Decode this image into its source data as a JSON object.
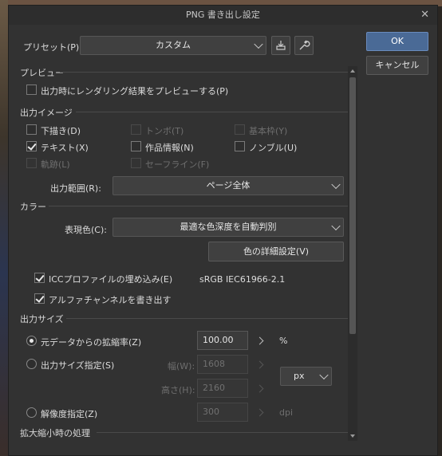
{
  "window": {
    "title": "PNG 書き出し設定",
    "close": "✕"
  },
  "preset": {
    "label": "プリセット(P):",
    "value": "カスタム"
  },
  "buttons": {
    "ok": "OK",
    "cancel": "キャンセル"
  },
  "preview": {
    "section": "プレビュー",
    "option": "出力時にレンダリング結果をプレビューする(P)",
    "checked": false
  },
  "output_image": {
    "section": "出力イメージ",
    "options": [
      {
        "label": "下描き(D)",
        "checked": false,
        "enabled": true
      },
      {
        "label": "トンボ(T)",
        "checked": false,
        "enabled": false
      },
      {
        "label": "基本枠(Y)",
        "checked": false,
        "enabled": false
      },
      {
        "label": "テキスト(X)",
        "checked": true,
        "enabled": true
      },
      {
        "label": "作品情報(N)",
        "checked": false,
        "enabled": true
      },
      {
        "label": "ノンブル(U)",
        "checked": false,
        "enabled": true
      },
      {
        "label": "軌跡(L)",
        "checked": false,
        "enabled": false
      },
      {
        "label": "セーフライン(F)",
        "checked": false,
        "enabled": false
      }
    ],
    "range_label": "出力範囲(R):",
    "range_value": "ページ全体"
  },
  "color": {
    "section": "カラー",
    "mode_label": "表現色(C):",
    "mode_value": "最適な色深度を自動判別",
    "detail_button": "色の詳細設定(V)",
    "icc_label": "ICCプロファイルの埋め込み(E)",
    "icc_checked": true,
    "icc_profile": "sRGB IEC61966-2.1",
    "alpha_label": "アルファチャンネルを書き出す",
    "alpha_checked": true
  },
  "output_size": {
    "section": "出力サイズ",
    "scale_label": "元データからの拡縮率(Z)",
    "scale_value": "100.00",
    "scale_unit": "%",
    "size_label": "出力サイズ指定(S)",
    "width_label": "幅(W):",
    "width_value": "1608",
    "height_label": "高さ(H):",
    "height_value": "2160",
    "unit_value": "px",
    "res_label": "解像度指定(Z)",
    "res_value": "300",
    "res_unit": "dpi",
    "selected": "scale"
  },
  "scaling": {
    "section": "拡大縮小時の処理"
  }
}
